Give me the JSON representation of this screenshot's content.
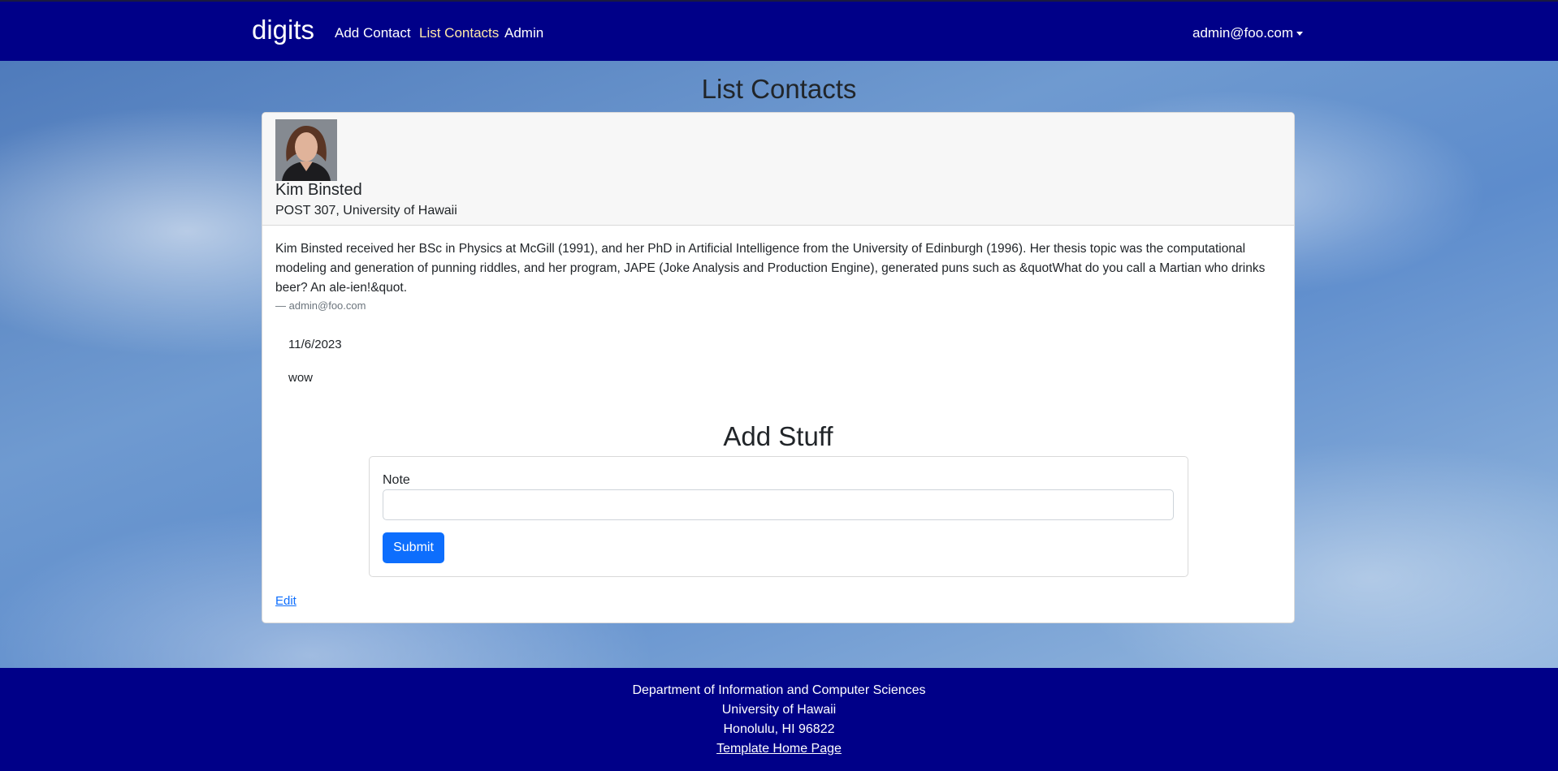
{
  "navbar": {
    "brand": "digits",
    "links": [
      {
        "label": "Add Contact",
        "active": false
      },
      {
        "label": "List Contacts",
        "active": true
      },
      {
        "label": "Admin",
        "active": false
      }
    ],
    "user": "admin@foo.com",
    "background": "#000088"
  },
  "page": {
    "title": "List Contacts"
  },
  "contact": {
    "name": "Kim Binsted",
    "address": "POST 307, University of Hawaii",
    "description": "Kim Binsted received her BSc in Physics at McGill (1991), and her PhD in Artificial Intelligence from the University of Edinburgh (1996). Her thesis topic was the computational modeling and generation of punning riddles, and her program, JAPE (Joke Analysis and Production Engine), generated puns such as &quotWhat do you call a Martian who drinks beer? An ale-ien!&quot.",
    "owner": "— admin@foo.com",
    "notes": [
      {
        "date": "11/6/2023",
        "text": "wow"
      }
    ],
    "edit_label": "Edit"
  },
  "add_stuff": {
    "title": "Add Stuff",
    "note_label": "Note",
    "note_value": "",
    "submit_label": "Submit",
    "submit_color": "#0d6efd"
  },
  "footer": {
    "line1": "Department of Information and Computer Sciences",
    "line2": "University of Hawaii",
    "line3": "Honolulu, HI 96822",
    "link": "Template Home Page"
  }
}
